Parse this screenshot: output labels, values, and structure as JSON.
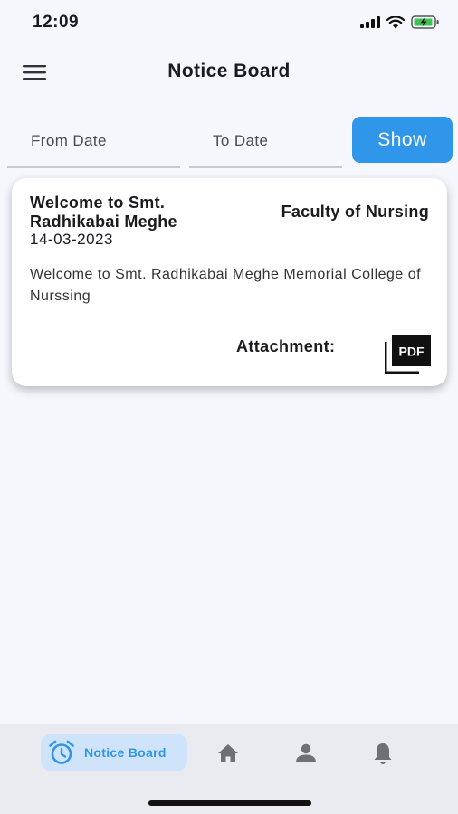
{
  "status_bar": {
    "time": "12:09",
    "icons": [
      "signal-icon",
      "wifi-icon",
      "battery-charging-icon"
    ]
  },
  "app_bar": {
    "title": "Notice Board",
    "menu_icon": "hamburger-menu-icon"
  },
  "filter": {
    "from_placeholder": "From Date",
    "to_placeholder": "To Date",
    "show_label": "Show"
  },
  "notice": {
    "title": "Welcome to Smt. Radhikabai Meghe",
    "date": "14-03-2023",
    "department": "Faculty of Nursing",
    "body": "Welcome to Smt. Radhikabai Meghe Memorial College of Nurssing",
    "attachment_label": "Attachment:",
    "attachment_icon": "pdf-icon",
    "attachment_text": "PDF"
  },
  "bottom_nav": {
    "active_label": "Notice Board",
    "items": [
      "alarm-clock-icon",
      "home-icon",
      "person-icon",
      "bell-icon"
    ]
  },
  "colors": {
    "accent": "#2f96ea",
    "background": "#f6f6fd",
    "nav_background": "#eaeaf1",
    "nav_active_bg": "#cfe4fb",
    "card": "#ffffff"
  }
}
